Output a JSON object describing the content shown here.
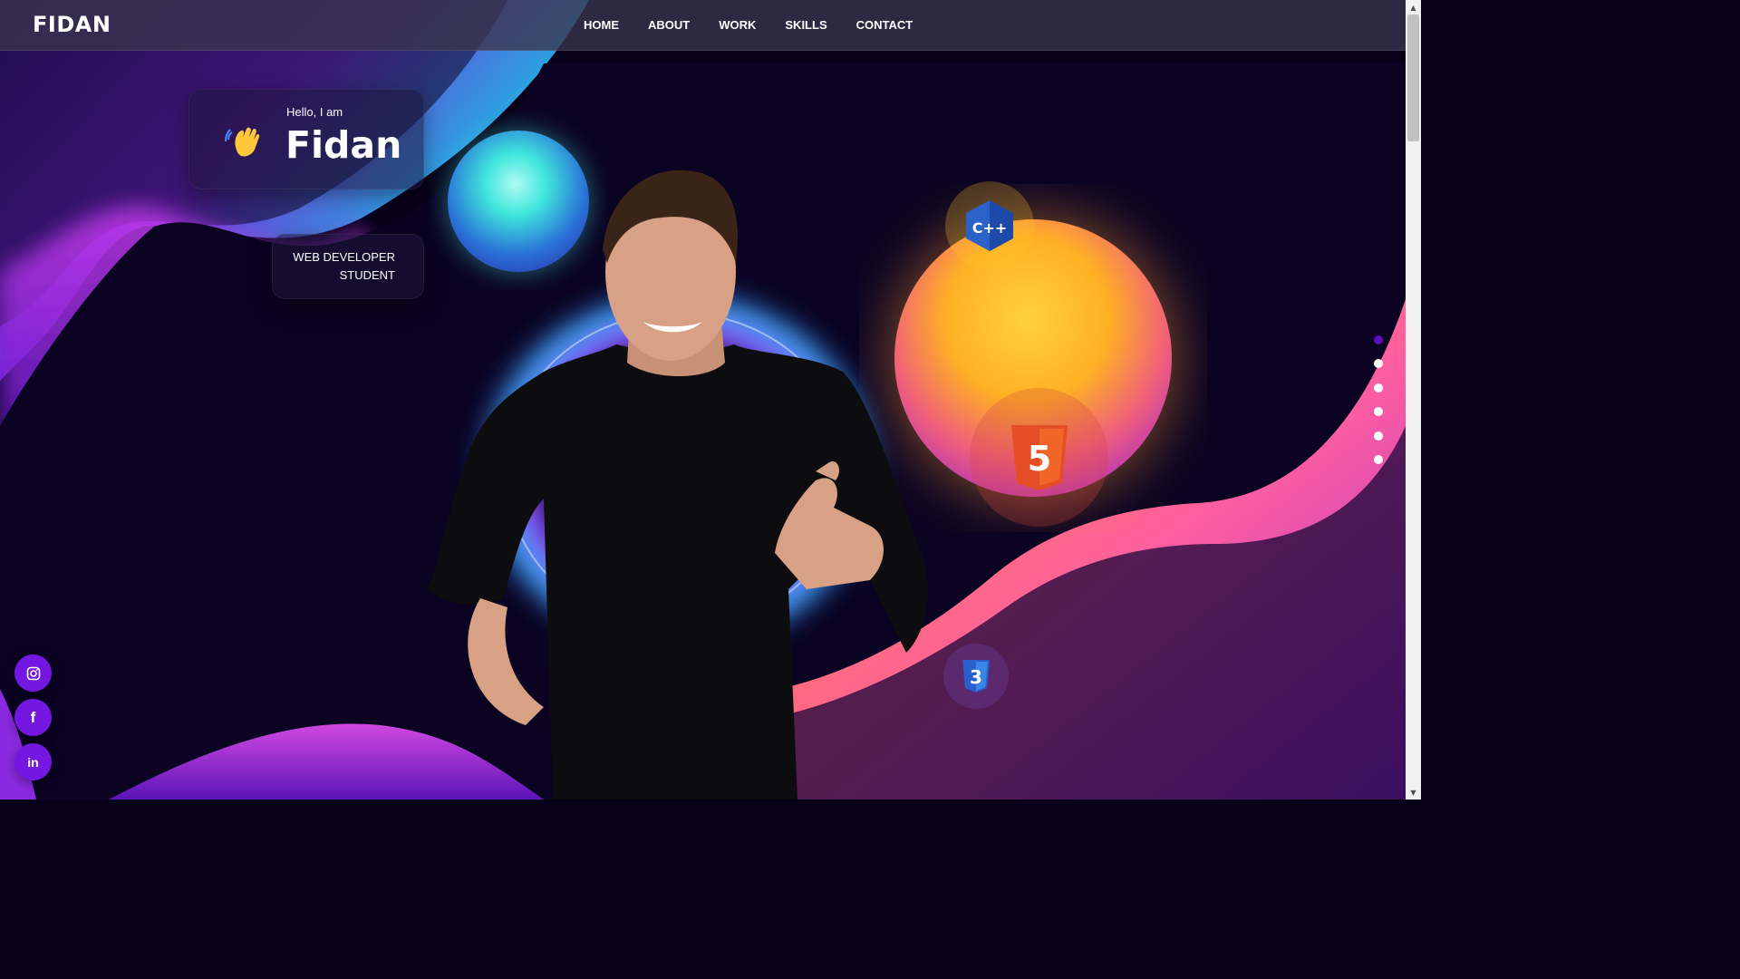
{
  "header": {
    "logo": "FIDAN",
    "nav": [
      "HOME",
      "ABOUT",
      "WORK",
      "SKILLS",
      "CONTACT"
    ]
  },
  "hero": {
    "greeting": "Hello, I am",
    "name": "Fidan",
    "role_line1": "WEB DEVELOPER",
    "role_line2": "STUDENT",
    "wave_icon": "waving-hand-icon"
  },
  "skills": {
    "icons": [
      "cpp-icon",
      "html5-icon",
      "css3-icon"
    ],
    "cpp_text": "C++",
    "html_text": "5",
    "css_text": "3"
  },
  "section_dots": {
    "count": 6,
    "active_index": 0
  },
  "social": {
    "icons": [
      "instagram-icon",
      "facebook-icon",
      "linkedin-icon"
    ],
    "facebook_glyph": "f",
    "linkedin_glyph": "in"
  },
  "colors": {
    "accent_purple": "#7417e0",
    "active_dot": "#5a0fb8",
    "background": "#07021a",
    "orange": "#ff8a1f",
    "cyan": "#3fe6dc"
  }
}
